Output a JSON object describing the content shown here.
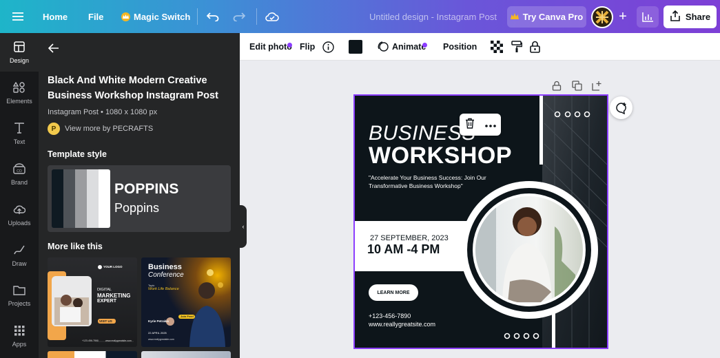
{
  "topbar": {
    "home": "Home",
    "file": "File",
    "magic_switch": "Magic Switch",
    "doc_title": "Untitled design - Instagram Post",
    "try_pro": "Try Canva Pro",
    "share": "Share"
  },
  "rail": {
    "items": [
      {
        "label": "Design",
        "icon": "layout-icon"
      },
      {
        "label": "Elements",
        "icon": "shapes-icon"
      },
      {
        "label": "Text",
        "icon": "text-icon"
      },
      {
        "label": "Brand",
        "icon": "brand-icon"
      },
      {
        "label": "Uploads",
        "icon": "upload-icon"
      },
      {
        "label": "Draw",
        "icon": "draw-icon"
      },
      {
        "label": "Projects",
        "icon": "folder-icon"
      },
      {
        "label": "Apps",
        "icon": "apps-grid-icon"
      }
    ]
  },
  "panel": {
    "template_title": "Black And White Modern Creative Business Workshop Instagram Post",
    "template_meta": "Instagram Post • 1080 x 1080 px",
    "creator_initial": "P",
    "creator_link": "View more by PECRAFTS",
    "style_heading": "Template style",
    "style_font_heading": "POPPINS",
    "style_font_body": "Poppins",
    "swatches": [
      "#0f1a22",
      "#4e5257",
      "#9b9c9f",
      "#dcdddf",
      "#ffffff"
    ],
    "more_heading": "More like this",
    "thumb1": {
      "logo": "YOUR LOGO",
      "line1": "DIGITAL",
      "line2": "MARKETING",
      "line3": "EXPERT",
      "cta": "VISIT US",
      "phone": "+123-456-7890",
      "site": "www.reallygreatsite.com"
    },
    "thumb2": {
      "title1": "Business",
      "title2": "Conference",
      "topic_label": "Topic",
      "topic": "Work Life Balance",
      "join": "Join Free!",
      "speaker": "Kyrie Petrakis",
      "date": "22 APRIL 2025",
      "site": "www.reallygreatsite.com"
    }
  },
  "context_bar": {
    "edit_photo": "Edit photo",
    "flip": "Flip",
    "animate": "Animate",
    "position": "Position",
    "fill_color": "#0d151a"
  },
  "design": {
    "title_line1": "BUSINESS",
    "title_line2": "WORKSHOP",
    "tagline": "\"Accelerate Your Business Success: Join Our Transformative Business Workshop\"",
    "date": "27 SEPTEMBER, 2023",
    "time": "10 AM -4 PM",
    "cta": "LEARN MORE",
    "phone": "+123-456-7890",
    "website": "www.reallygreatsite.com"
  }
}
